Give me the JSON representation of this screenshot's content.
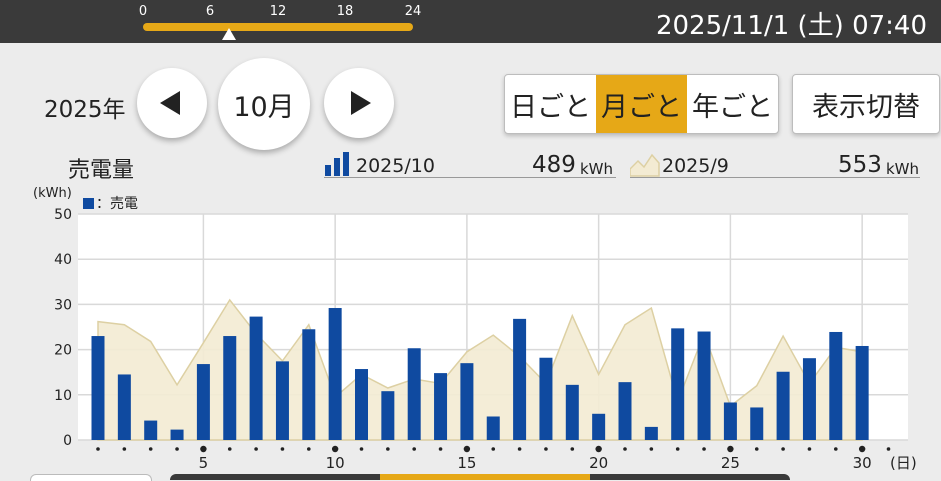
{
  "header": {
    "timeline_ticks": [
      "0",
      "6",
      "12",
      "18",
      "24"
    ],
    "timeline_position_hours": 7.67,
    "datetime": "2025/11/1 (土) 07:40"
  },
  "nav": {
    "year_label": "2025年",
    "month_label": "10月",
    "prev_icon": "triangle-left-icon",
    "next_icon": "triangle-right-icon"
  },
  "period_tabs": [
    {
      "label": "日ごと",
      "active": false
    },
    {
      "label": "月ごと",
      "active": true
    },
    {
      "label": "年ごと",
      "active": false
    }
  ],
  "display_toggle_label": "表示切替",
  "summary": {
    "current": {
      "label": "2025/10",
      "value": "489",
      "unit": "kWh",
      "icon": "bar-chart-icon"
    },
    "previous": {
      "label": "2025/9",
      "value": "553",
      "unit": "kWh",
      "icon": "area-chart-icon"
    }
  },
  "colors": {
    "accent": "#e6a817",
    "bar": "#0f4aa0",
    "area_fill": "#f3ebd3",
    "area_line": "#ddd0a3",
    "top_bar": "#3a3a3a"
  },
  "chart_data": {
    "type": "bar",
    "title": "売電量",
    "ylabel": "(kWh)",
    "xlabel": "(日)",
    "legend": "：売電",
    "ylim": [
      0,
      50
    ],
    "yticks": [
      0,
      10,
      20,
      30,
      40,
      50
    ],
    "xticks": [
      5,
      10,
      15,
      20,
      25,
      30
    ],
    "days": [
      1,
      2,
      3,
      4,
      5,
      6,
      7,
      8,
      9,
      10,
      11,
      12,
      13,
      14,
      15,
      16,
      17,
      18,
      19,
      20,
      21,
      22,
      23,
      24,
      25,
      26,
      27,
      28,
      29,
      30,
      31
    ],
    "series": [
      {
        "name": "2025/10",
        "type": "bar",
        "values": [
          23,
          14.5,
          4.3,
          2.3,
          16.8,
          23,
          27.3,
          17.4,
          24.5,
          29.2,
          15.7,
          10.8,
          20.3,
          14.8,
          17,
          5.2,
          26.8,
          18.2,
          12.2,
          5.8,
          12.8,
          2.9,
          24.7,
          24,
          8.3,
          7.2,
          15.1,
          18.1,
          23.9,
          20.8,
          null
        ]
      },
      {
        "name": "2025/9",
        "type": "area",
        "values": [
          26.2,
          25.5,
          21.8,
          12.2,
          21.5,
          31,
          23.5,
          17.5,
          25.5,
          9.5,
          14.5,
          11.5,
          13.5,
          12.5,
          19.5,
          23.2,
          18.5,
          12.5,
          27.5,
          14.5,
          25.5,
          29.2,
          8.5,
          23.5,
          7.5,
          12,
          23,
          12.5,
          20.5,
          19.5
        ]
      }
    ],
    "grid": true
  }
}
